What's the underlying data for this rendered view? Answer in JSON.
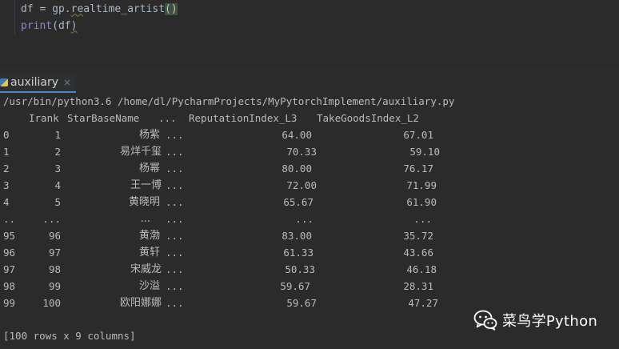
{
  "editor": {
    "lines": [
      {
        "pre": "df = gp.",
        "underlined": "re",
        "post": "altime_artist",
        "brackets": "()"
      },
      {
        "builtin": "print",
        "args": "(df",
        "close": ")"
      }
    ]
  },
  "tool_tab": {
    "label": "auxiliary",
    "close": "×",
    "icon": "python-file-icon"
  },
  "console": {
    "command": "/usr/bin/python3.6 /home/dl/PycharmProjects/MyPytorchImplement/auxiliary.py",
    "columns": [
      "Irank",
      "StarBaseName",
      "...",
      "ReputationIndex_L3",
      "TakeGoodsIndex_L2"
    ],
    "rows": [
      {
        "idx": "0",
        "irank": "1",
        "name": "杨紫",
        "dots": "...",
        "rep": "64.00",
        "take": "67.01"
      },
      {
        "idx": "1",
        "irank": "2",
        "name": "易烊千玺",
        "dots": "...",
        "rep": "70.33",
        "take": "59.10"
      },
      {
        "idx": "2",
        "irank": "3",
        "name": "杨幂",
        "dots": "...",
        "rep": "80.00",
        "take": "76.17"
      },
      {
        "idx": "3",
        "irank": "4",
        "name": "王一博",
        "dots": "...",
        "rep": "72.00",
        "take": "71.99"
      },
      {
        "idx": "4",
        "irank": "5",
        "name": "黄晓明",
        "dots": "...",
        "rep": "65.67",
        "take": "61.90"
      },
      {
        "idx": "..",
        "irank": "...",
        "name": "...",
        "dots": "...",
        "rep": "...",
        "take": "..."
      },
      {
        "idx": "95",
        "irank": "96",
        "name": "黄渤",
        "dots": "...",
        "rep": "83.00",
        "take": "35.72"
      },
      {
        "idx": "96",
        "irank": "97",
        "name": "黄轩",
        "dots": "...",
        "rep": "61.33",
        "take": "43.66"
      },
      {
        "idx": "97",
        "irank": "98",
        "name": "宋威龙",
        "dots": "...",
        "rep": "50.33",
        "take": "46.18"
      },
      {
        "idx": "98",
        "irank": "99",
        "name": "沙溢",
        "dots": "...",
        "rep": "59.67",
        "take": "28.31"
      },
      {
        "idx": "99",
        "irank": "100",
        "name": "欧阳娜娜",
        "dots": "...",
        "rep": "59.67",
        "take": "47.27"
      }
    ],
    "summary": "[100 rows x 9 columns]"
  },
  "watermark": {
    "text": "菜鸟学Python",
    "icon": "wechat-icon"
  }
}
